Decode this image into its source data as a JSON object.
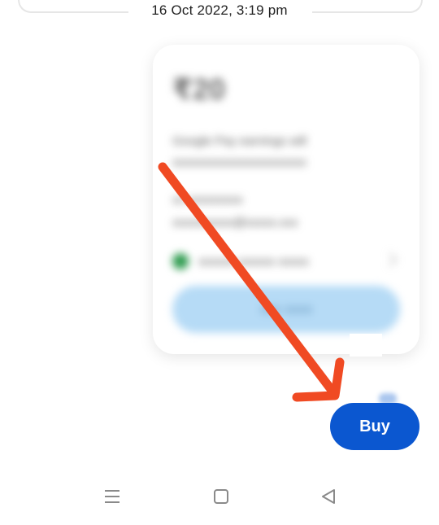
{
  "conversation": {
    "date_separator": "16 Oct 2022, 3:19 pm"
  },
  "payment_card": {
    "amount": "₹20",
    "line_1": "Google Pay earnings will",
    "line_2": "xxxxxxxxxxxxxxxxxxxxxx",
    "line_3": "xx xxxxxxxxx",
    "line_4": "xxxxxxxxxx@xxxxx.xxx",
    "line_5": "xxxxxx xxxxxx xxxxx",
    "cta_label": "xxx xxxx"
  },
  "actions": {
    "buy_label": "Buy",
    "buy_color": "#0b57d0"
  },
  "annotation": {
    "arrow_color": "#f04a23"
  },
  "nav_bar": {
    "menu_icon": "menu-icon",
    "home_icon": "home-icon",
    "back_icon": "back-icon"
  }
}
